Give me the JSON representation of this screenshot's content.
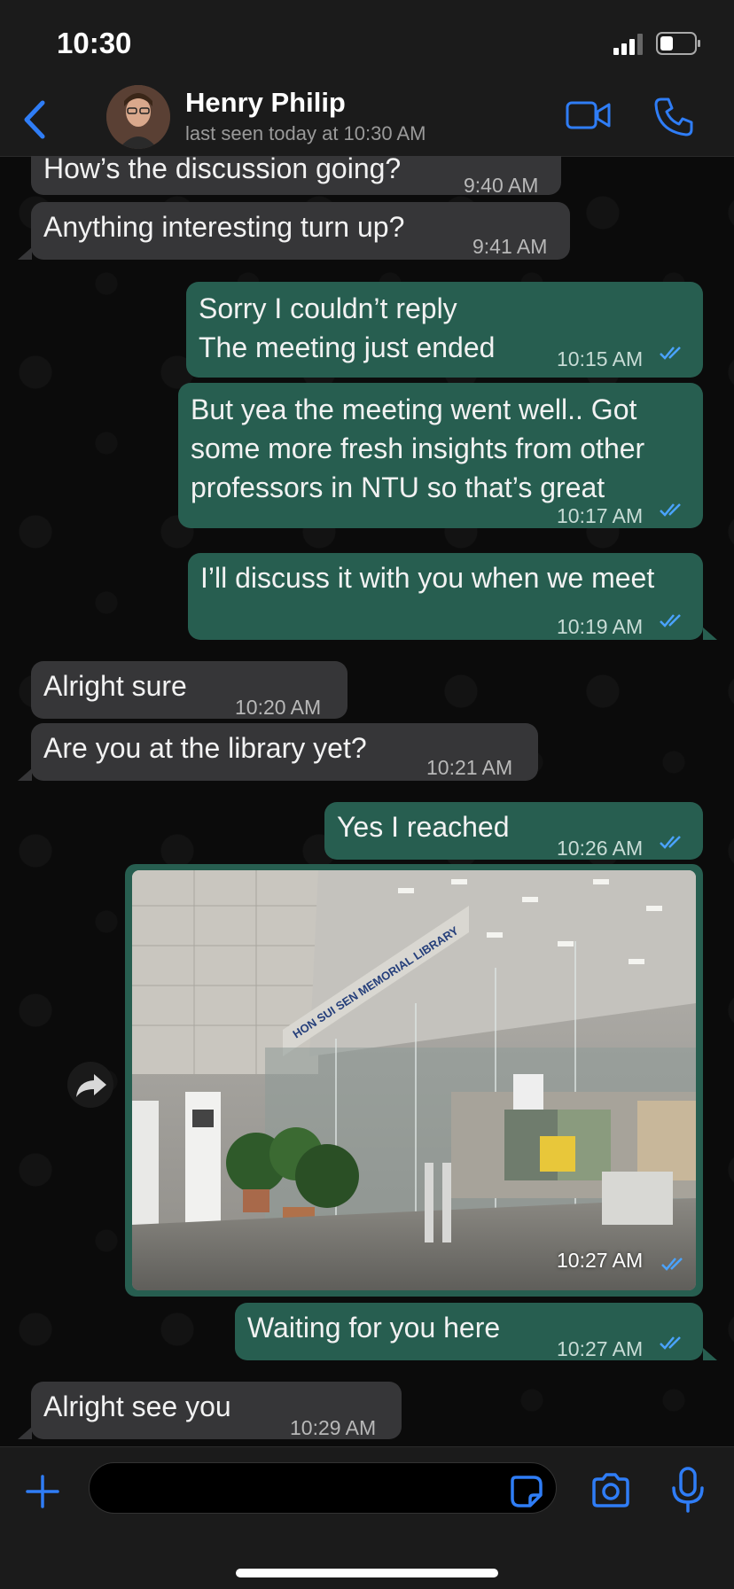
{
  "status_bar": {
    "time": "10:30"
  },
  "header": {
    "contact_name": "Henry Philip",
    "contact_status": "last seen today at 10:30 AM"
  },
  "messages": [
    {
      "direction": "in",
      "text": "How’s the discussion going?",
      "time": "9:40 AM"
    },
    {
      "direction": "in",
      "text": "Anything interesting turn up?",
      "time": "9:41 AM"
    },
    {
      "direction": "out",
      "text": "Sorry I couldn’t reply\nThe meeting just ended",
      "time": "10:15 AM",
      "read": true
    },
    {
      "direction": "out",
      "text": "But yea the meeting went well.. Got\nsome more fresh insights from other\nprofessors in NTU so that’s great",
      "time": "10:17 AM",
      "read": true
    },
    {
      "direction": "out",
      "text": "I’ll discuss it with you when we meet",
      "time": "10:19 AM",
      "read": true
    },
    {
      "direction": "in",
      "text": "Alright sure",
      "time": "10:20 AM"
    },
    {
      "direction": "in",
      "text": "Are you at the library yet?",
      "time": "10:21 AM"
    },
    {
      "direction": "out",
      "text": "Yes I reached",
      "time": "10:26 AM",
      "read": true
    },
    {
      "direction": "out",
      "type": "image",
      "image_sign_text": "HON SUI SEN MEMORIAL LIBRARY",
      "time": "10:27 AM",
      "read": true
    },
    {
      "direction": "out",
      "text": "Waiting for you here",
      "time": "10:27 AM",
      "read": true
    },
    {
      "direction": "in",
      "text": "Alright see you",
      "time": "10:29 AM"
    }
  ],
  "colors": {
    "accent": "#2f7df6",
    "incoming_bubble": "#363638",
    "outgoing_bubble": "#275e50",
    "read_ticks": "#4aa3ff"
  },
  "icons": {
    "back": "chevron-left-icon",
    "video": "video-camera-icon",
    "call": "phone-icon",
    "forward": "forward-arrow-icon",
    "plus": "plus-icon",
    "sticker": "sticker-icon",
    "camera": "camera-icon",
    "mic": "microphone-icon"
  }
}
